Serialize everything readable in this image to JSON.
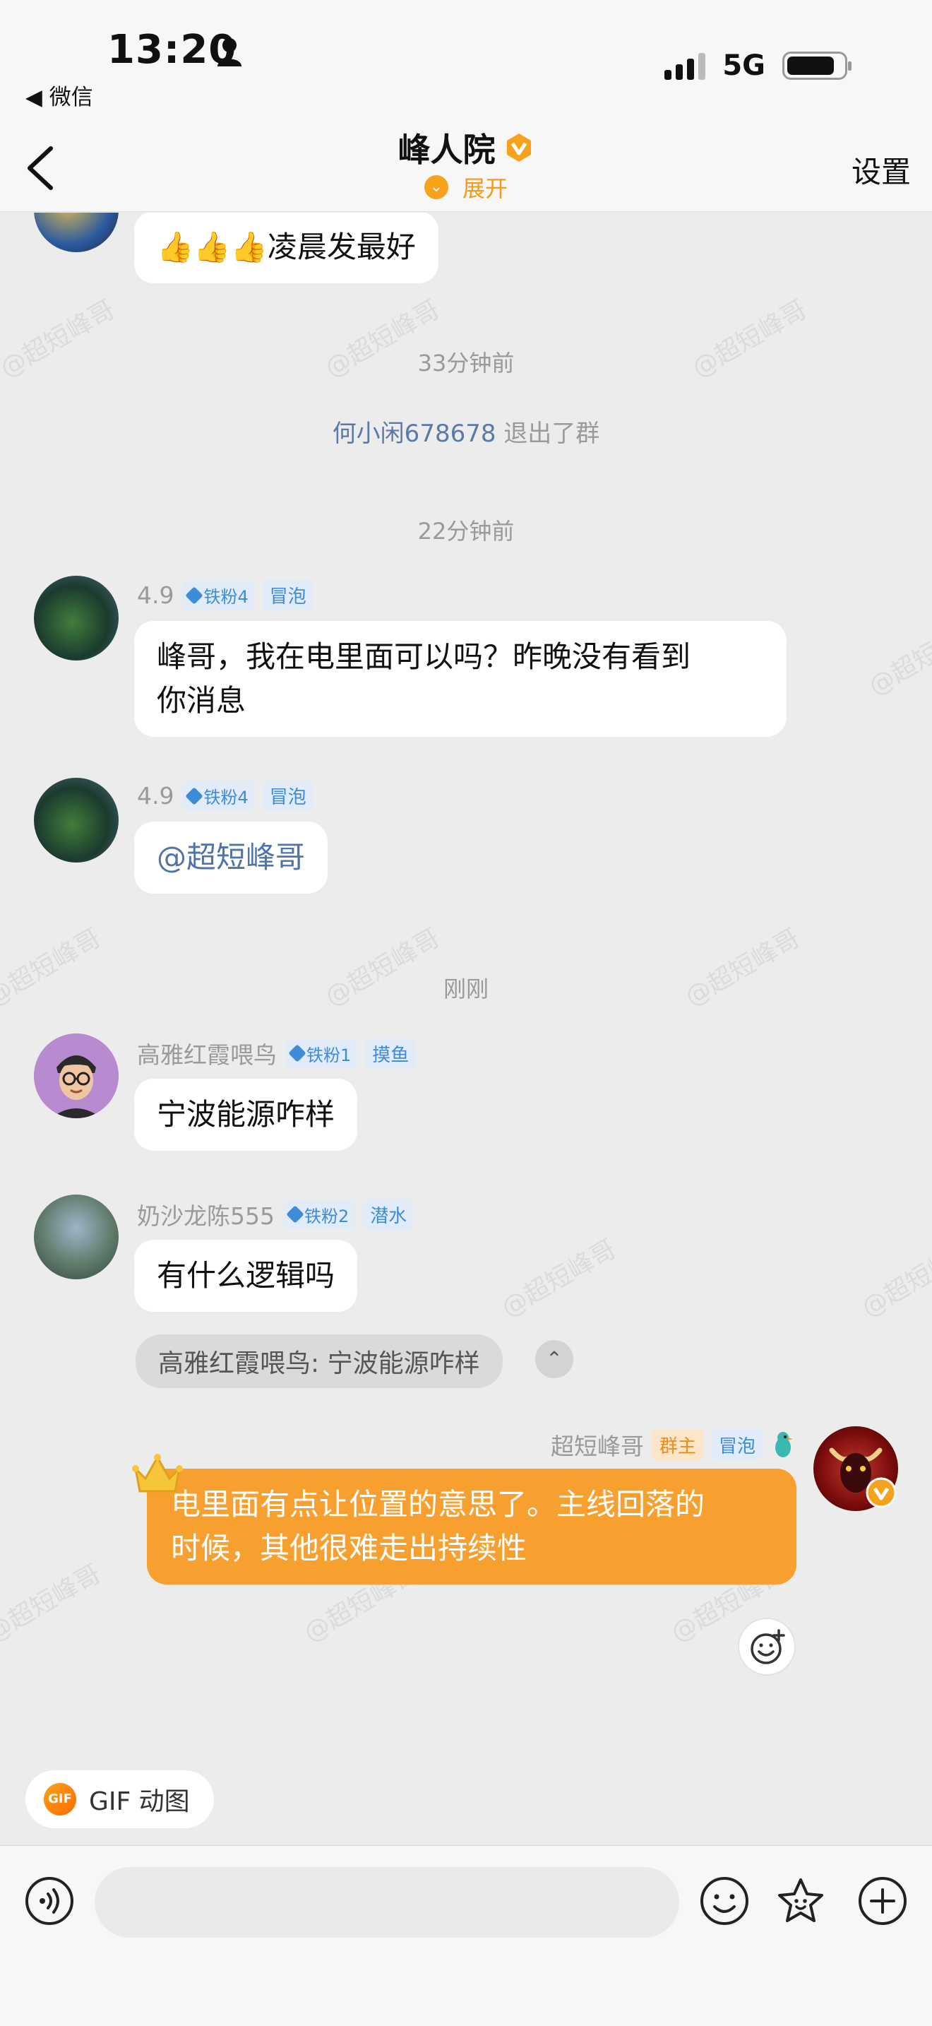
{
  "status_bar": {
    "time": "13:20",
    "back_app": "◀ 微信",
    "network": "5G"
  },
  "nav": {
    "title": "峰人院",
    "expand_label": "展开",
    "settings_label": "设置"
  },
  "watermark_text": "@超短峰哥",
  "messages": {
    "top_bubble": {
      "text": "👍👍👍凌晨发最好"
    },
    "sep_1": "33分钟前",
    "system_leave": {
      "user": "何小闲678678",
      "action": " 退出了群"
    },
    "sep_2": "22分钟前",
    "msg_1": {
      "sender": "4.9",
      "fan_tag": "铁粉4",
      "act_tag": "冒泡",
      "line_1": "峰哥，我在电里面可以吗？昨晚没有看到",
      "line_2": "你消息"
    },
    "msg_2": {
      "sender": "4.9",
      "fan_tag": "铁粉4",
      "act_tag": "冒泡",
      "text": "@超短峰哥"
    },
    "sep_3": "刚刚",
    "msg_3": {
      "sender": "高雅红霞喂鸟",
      "fan_tag": "铁粉1",
      "act_tag": "摸鱼",
      "text": "宁波能源咋样"
    },
    "msg_4": {
      "sender": "奶沙龙陈555",
      "fan_tag": "铁粉2",
      "act_tag": "潜水",
      "text": "有什么逻辑吗",
      "quote": "高雅红霞喂鸟: 宁波能源咋样",
      "quote_toggle": "⌃"
    },
    "msg_5": {
      "sender": "超短峰哥",
      "owner_tag": "群主",
      "act_tag": "冒泡",
      "line_1": "电里面有点让位置的意思了。主线回落的",
      "line_2": "时候，其他很难走出持续性"
    }
  },
  "gif_chip": {
    "icon_text": "GIF",
    "label": "GIF 动图"
  },
  "input": {
    "placeholder": ""
  },
  "colors": {
    "accent_orange": "#f7a030",
    "mention_blue": "#4f74a8",
    "tag_blue": "#3e8bd8"
  }
}
